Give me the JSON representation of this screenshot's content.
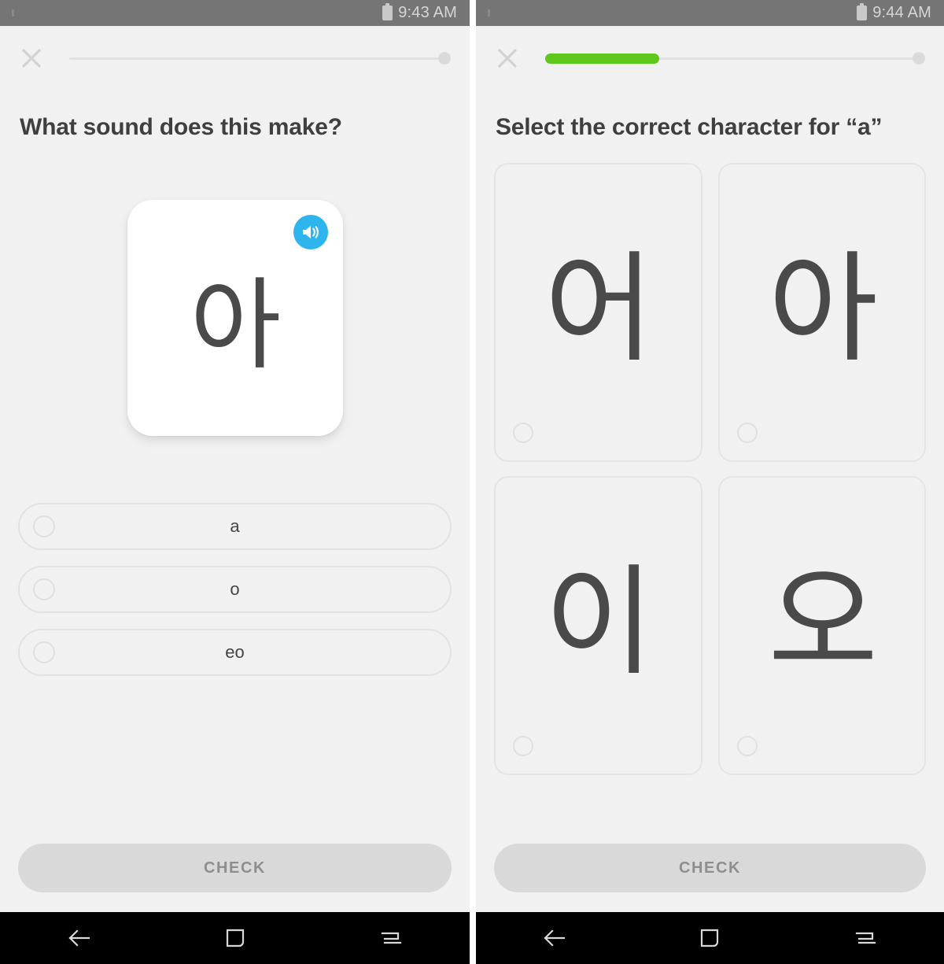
{
  "app": {
    "background_color": "#f1f1f1",
    "accent_green": "#60c81c",
    "accent_blue": "#2eb5ee"
  },
  "screens": [
    {
      "id": "listening-exercise",
      "status_bar": {
        "time": "9:43 AM",
        "battery_icon": "battery-icon"
      },
      "close_icon": "close-icon",
      "progress": {
        "percent": 0,
        "knob": true
      },
      "prompt": "What sound does this make?",
      "flashcard": {
        "character": "아",
        "speaker_icon": "speaker-icon"
      },
      "options": [
        {
          "label": "a",
          "selected": false
        },
        {
          "label": "o",
          "selected": false
        },
        {
          "label": "eo",
          "selected": false
        }
      ],
      "check_button": {
        "label": "CHECK",
        "enabled": false
      },
      "nav_bar": {
        "back_icon": "back-arrow-icon",
        "home_icon": "home-square-icon",
        "recents_icon": "recent-apps-icon"
      }
    },
    {
      "id": "character-selection-exercise",
      "status_bar": {
        "time": "9:44 AM",
        "battery_icon": "battery-icon"
      },
      "close_icon": "close-icon",
      "progress": {
        "percent": 30,
        "knob": true
      },
      "prompt": "Select the correct character for “a”",
      "char_cards": [
        {
          "character": "어",
          "selected": false
        },
        {
          "character": "아",
          "selected": false
        },
        {
          "character": "이",
          "selected": false
        },
        {
          "character": "오",
          "selected": false
        }
      ],
      "check_button": {
        "label": "CHECK",
        "enabled": false
      },
      "nav_bar": {
        "back_icon": "back-arrow-icon",
        "home_icon": "home-square-icon",
        "recents_icon": "recent-apps-icon"
      }
    }
  ]
}
